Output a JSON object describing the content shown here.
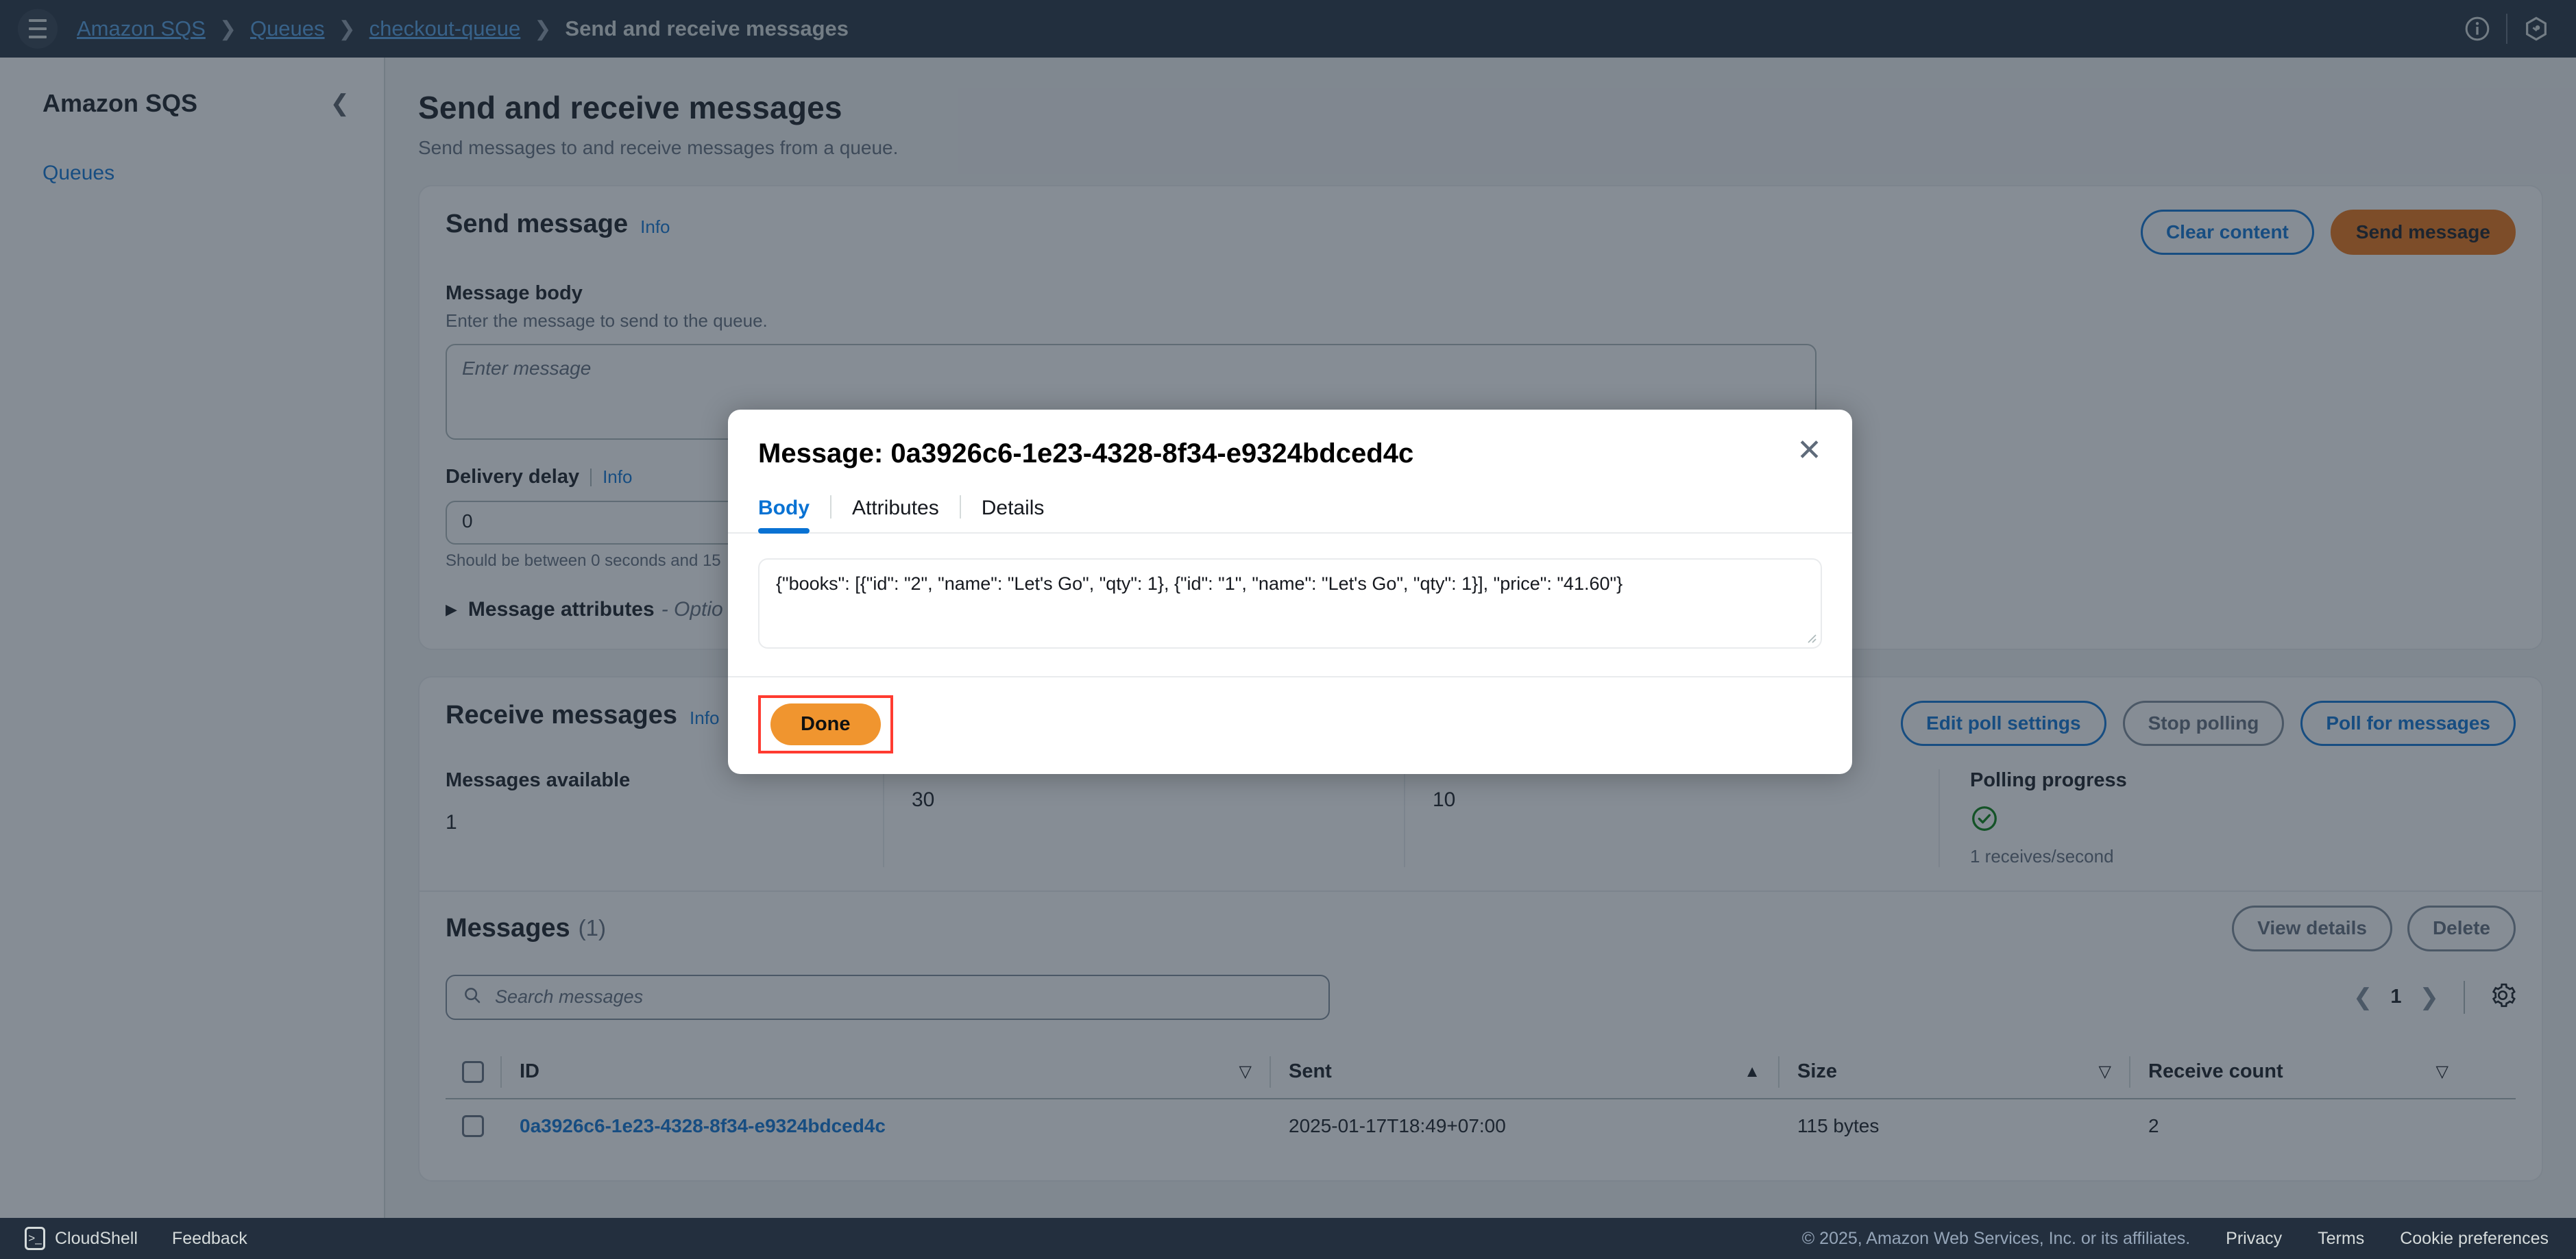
{
  "topnav": {
    "menu_icon": "hamburger-icon",
    "breadcrumbs": [
      {
        "label": "Amazon SQS",
        "current": false
      },
      {
        "label": "Queues",
        "current": false
      },
      {
        "label": "checkout-queue",
        "current": false
      },
      {
        "label": "Send and receive messages",
        "current": true
      }
    ],
    "separator": "❯",
    "info_icon": "info-icon",
    "settings_icon": "settings-icon"
  },
  "sidebar": {
    "title": "Amazon SQS",
    "collapse_icon": "chevron-left-icon",
    "items": [
      {
        "label": "Queues"
      }
    ]
  },
  "page": {
    "title": "Send and receive messages",
    "subtitle": "Send messages to and receive messages from a queue."
  },
  "send_message": {
    "title": "Send message",
    "info_label": "Info",
    "clear_button": "Clear content",
    "send_button": "Send message",
    "message_body": {
      "label": "Message body",
      "description": "Enter the message to send to the queue.",
      "placeholder": "Enter message",
      "value": ""
    },
    "delivery_delay": {
      "label": "Delivery delay",
      "info_label": "Info",
      "value": "0",
      "hint": "Should be between 0 seconds and 15"
    },
    "attributes": {
      "label": "Message attributes",
      "optional": "- Optio",
      "expand_icon": "triangle-right-icon"
    }
  },
  "receive_messages": {
    "title": "Receive messages",
    "info_label": "Info",
    "edit_poll_button": "Edit poll settings",
    "stop_polling_button": "Stop polling",
    "poll_button": "Poll for messages",
    "stats": [
      {
        "label": "Messages available",
        "value": "1"
      },
      {
        "label": "",
        "value": "30"
      },
      {
        "label": "",
        "value": "10"
      }
    ],
    "polling": {
      "label": "Polling progress",
      "status_icon": "check-circle-icon",
      "rate": "1 receives/second"
    }
  },
  "messages_table": {
    "title": "Messages",
    "count": "(1)",
    "view_details_button": "View details",
    "delete_button": "Delete",
    "search_placeholder": "Search messages",
    "search_icon": "search-icon",
    "search_value": "",
    "pagination": {
      "prev_icon": "chevron-left-icon",
      "page": "1",
      "next_icon": "chevron-right-icon",
      "settings_icon": "gear-icon"
    },
    "columns": [
      {
        "label": "ID",
        "sort": "▽"
      },
      {
        "label": "Sent",
        "sort": "▲"
      },
      {
        "label": "Size",
        "sort": "▽"
      },
      {
        "label": "Receive count",
        "sort": "▽"
      }
    ],
    "rows": [
      {
        "id": "0a3926c6-1e23-4328-8f34-e9324bdced4c",
        "sent": "2025-01-17T18:49+07:00",
        "size": "115 bytes",
        "receive_count": "2"
      }
    ]
  },
  "modal": {
    "title": "Message: 0a3926c6-1e23-4328-8f34-e9324bdced4c",
    "close_icon": "close-icon",
    "tabs": [
      {
        "label": "Body",
        "active": true
      },
      {
        "label": "Attributes",
        "active": false
      },
      {
        "label": "Details",
        "active": false
      }
    ],
    "body_text": "{\"books\": [{\"id\": \"2\", \"name\": \"Let's Go\", \"qty\": 1}, {\"id\": \"1\", \"name\": \"Let's Go\", \"qty\": 1}], \"price\": \"41.60\"}",
    "done_button": "Done"
  },
  "footer": {
    "cloudshell": "CloudShell",
    "feedback": "Feedback",
    "copyright": "© 2025, Amazon Web Services, Inc. or its affiliates.",
    "privacy": "Privacy",
    "terms": "Terms",
    "cookies": "Cookie preferences"
  },
  "colors": {
    "accent": "#0972d3",
    "primary_button": "#ec7211",
    "done_button": "#f0952f",
    "highlight": "#ff3b30",
    "nav_bg": "#232f3e",
    "success": "#037f0c"
  }
}
